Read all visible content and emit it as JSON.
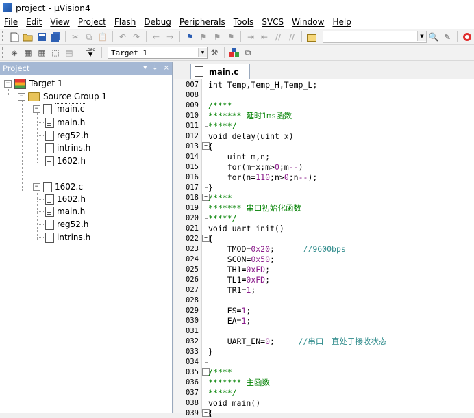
{
  "window": {
    "title": "project  - µVision4"
  },
  "menu": [
    "File",
    "Edit",
    "View",
    "Project",
    "Flash",
    "Debug",
    "Peripherals",
    "Tools",
    "SVCS",
    "Window",
    "Help"
  ],
  "toolbar2": {
    "load_label": "Load",
    "target_value": "Target 1"
  },
  "project_panel": {
    "title": "Project",
    "controls": {
      "dropdown": "▾",
      "pin": "↓",
      "close": "×"
    },
    "tree": {
      "target": "Target 1",
      "group": "Source Group 1",
      "files": [
        {
          "name": "main.c",
          "children": [
            "main.h",
            "reg52.h",
            "intrins.h",
            "1602.h"
          ]
        },
        {
          "name": "1602.c",
          "children": [
            "1602.h",
            "main.h",
            "reg52.h",
            "intrins.h"
          ]
        }
      ]
    }
  },
  "editor": {
    "tab_label": "main.c",
    "lines": [
      {
        "num": "007",
        "text": "int Temp,Temp_H,Temp_L;"
      },
      {
        "num": "008",
        "text": ""
      },
      {
        "num": "009",
        "text": "/****"
      },
      {
        "num": "010",
        "text": "******* 延时1ms函数"
      },
      {
        "num": "011",
        "text": "*****/"
      },
      {
        "num": "012",
        "text": "void delay(uint x)"
      },
      {
        "num": "013",
        "text": "{"
      },
      {
        "num": "014",
        "text": "    uint m,n;"
      },
      {
        "num": "015",
        "text": "    for(m=x;m>0;m--)"
      },
      {
        "num": "016",
        "text": "    for(n=110;n>0;n--);"
      },
      {
        "num": "017",
        "text": "}"
      },
      {
        "num": "018",
        "text": "/****"
      },
      {
        "num": "019",
        "text": "******* 串口初始化函数"
      },
      {
        "num": "020",
        "text": "*****/"
      },
      {
        "num": "021",
        "text": "void uart_init()"
      },
      {
        "num": "022",
        "text": "{"
      },
      {
        "num": "023",
        "text": "    TMOD=0x20;      //9600bps"
      },
      {
        "num": "024",
        "text": "    SCON=0x50;"
      },
      {
        "num": "025",
        "text": "    TH1=0xFD;"
      },
      {
        "num": "026",
        "text": "    TL1=0xFD;"
      },
      {
        "num": "027",
        "text": "    TR1=1;"
      },
      {
        "num": "028",
        "text": ""
      },
      {
        "num": "029",
        "text": "    ES=1;"
      },
      {
        "num": "030",
        "text": "    EA=1;"
      },
      {
        "num": "031",
        "text": ""
      },
      {
        "num": "032",
        "text": "    UART_EN=0;     //串口一直处于接收状态"
      },
      {
        "num": "033",
        "text": "}"
      },
      {
        "num": "034",
        "text": ""
      },
      {
        "num": "035",
        "text": "/****"
      },
      {
        "num": "036",
        "text": "******* 主函数"
      },
      {
        "num": "037",
        "text": "*****/"
      },
      {
        "num": "038",
        "text": "void main()"
      },
      {
        "num": "039",
        "text": "{"
      }
    ]
  }
}
